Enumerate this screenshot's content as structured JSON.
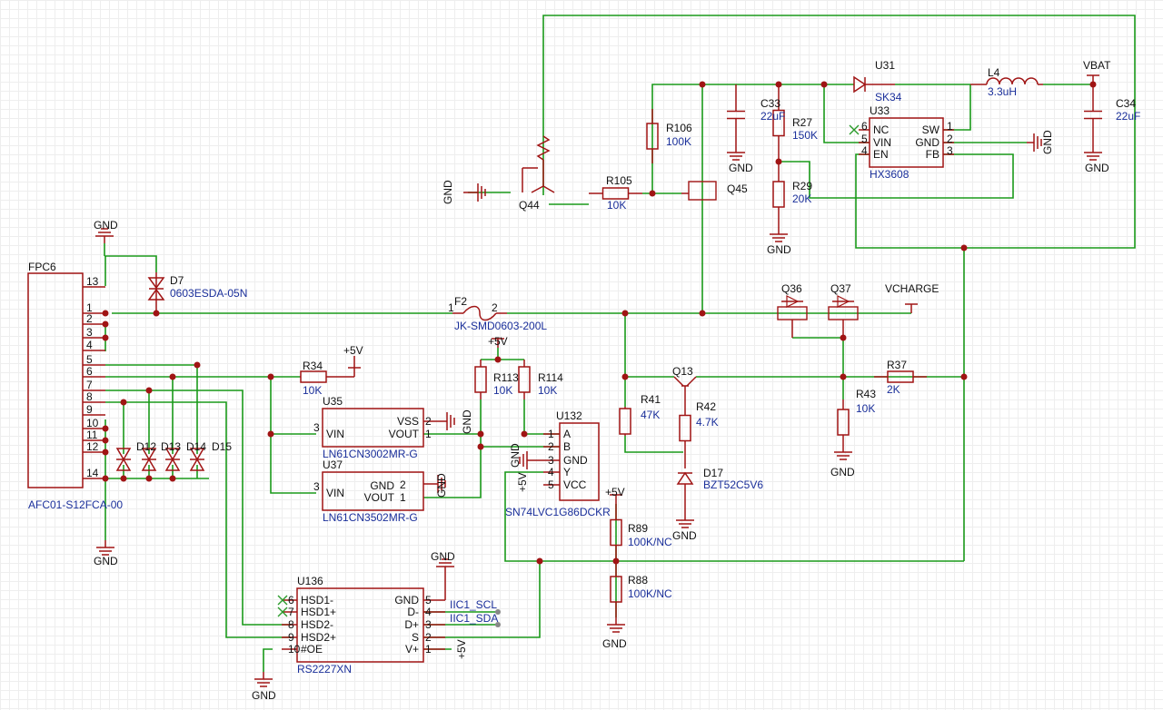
{
  "colors": {
    "wire": "#1a9a1a",
    "part": "#a01414",
    "ref": "#111111",
    "value": "#1a2f9a",
    "background": "#ffffff"
  },
  "nets": {
    "vbat": "VBAT",
    "vcharge": "VCHARGE",
    "plus5v": "+5V",
    "gnd": "GND",
    "iic_scl": "IIC1_SCL",
    "iic_sda": "IIC1_SDA"
  },
  "parts": {
    "u31": {
      "ref": "U31",
      "value": "SK34"
    },
    "l4": {
      "ref": "L4",
      "value": "3.3uH"
    },
    "c34": {
      "ref": "C34",
      "value": "22uF"
    },
    "c33": {
      "ref": "C33",
      "value": "22uF"
    },
    "r27": {
      "ref": "R27",
      "value": "150K"
    },
    "r29": {
      "ref": "R29",
      "value": "20K"
    },
    "r106": {
      "ref": "R106",
      "value": "100K"
    },
    "r105": {
      "ref": "R105",
      "value": "10K"
    },
    "q44": {
      "ref": "Q44"
    },
    "q45": {
      "ref": "Q45"
    },
    "u33": {
      "ref": "U33",
      "value": "HX3608",
      "pins": {
        "nc": "NC",
        "vin": "VIN",
        "en": "EN",
        "sw": "SW",
        "gnd": "GND",
        "fb": "FB"
      },
      "pin_numbers": [
        "6",
        "5",
        "4",
        "1",
        "2",
        "3"
      ]
    },
    "fpc6": {
      "ref": "FPC6",
      "value": "AFC01-S12FCA-00",
      "pins": [
        "13",
        "1",
        "2",
        "3",
        "4",
        "5",
        "6",
        "7",
        "8",
        "9",
        "10",
        "11",
        "12",
        "14"
      ]
    },
    "d7": {
      "ref": "D7",
      "value": "0603ESDA-05N"
    },
    "f2": {
      "ref": "F2",
      "value": "JK-SMD0603-200L",
      "pins": [
        "1",
        "2"
      ]
    },
    "q36": {
      "ref": "Q36"
    },
    "q37": {
      "ref": "Q37"
    },
    "r34": {
      "ref": "R34",
      "value": "10K"
    },
    "r113": {
      "ref": "R113",
      "value": "10K"
    },
    "r114": {
      "ref": "R114",
      "value": "10K"
    },
    "u35": {
      "ref": "U35",
      "value": "LN61CN3002MR-G",
      "pins": {
        "vin": "VIN",
        "vss": "VSS",
        "vout": "VOUT"
      },
      "pin_numbers": [
        "3",
        "2",
        "1"
      ]
    },
    "u37": {
      "ref": "U37",
      "value": "LN61CN3502MR-G",
      "pins": {
        "vin": "VIN",
        "gnd": "GND",
        "vout": "VOUT"
      },
      "pin_numbers": [
        "3",
        "2",
        "1"
      ]
    },
    "u132": {
      "ref": "U132",
      "value": "SN74LVC1G86DCKR",
      "pins": [
        "A",
        "B",
        "GND",
        "Y",
        "VCC"
      ],
      "pin_numbers": [
        "1",
        "2",
        "3",
        "4",
        "5"
      ]
    },
    "q13": {
      "ref": "Q13"
    },
    "r41": {
      "ref": "R41",
      "value": "47K"
    },
    "r42": {
      "ref": "R42",
      "value": "4.7K"
    },
    "d17": {
      "ref": "D17",
      "value": "BZT52C5V6"
    },
    "r43": {
      "ref": "R43",
      "value": "10K"
    },
    "r37": {
      "ref": "R37",
      "value": "2K"
    },
    "r89": {
      "ref": "R89",
      "value": "100K/NC"
    },
    "r88": {
      "ref": "R88",
      "value": "100K/NC"
    },
    "d12": {
      "ref": "D12"
    },
    "d13": {
      "ref": "D13"
    },
    "d14": {
      "ref": "D14"
    },
    "d15": {
      "ref": "D15"
    },
    "u136": {
      "ref": "U136",
      "value": "RS2227XN",
      "left_pins": [
        "HSD1-",
        "HSD1+",
        "HSD2-",
        "HSD2+",
        "#OE"
      ],
      "left_pin_numbers": [
        "6",
        "7",
        "8",
        "9",
        "10"
      ],
      "right_pins": [
        "GND",
        "D-",
        "D+",
        "S",
        "V+"
      ],
      "right_pin_numbers": [
        "5",
        "4",
        "3",
        "2",
        "1"
      ]
    }
  }
}
